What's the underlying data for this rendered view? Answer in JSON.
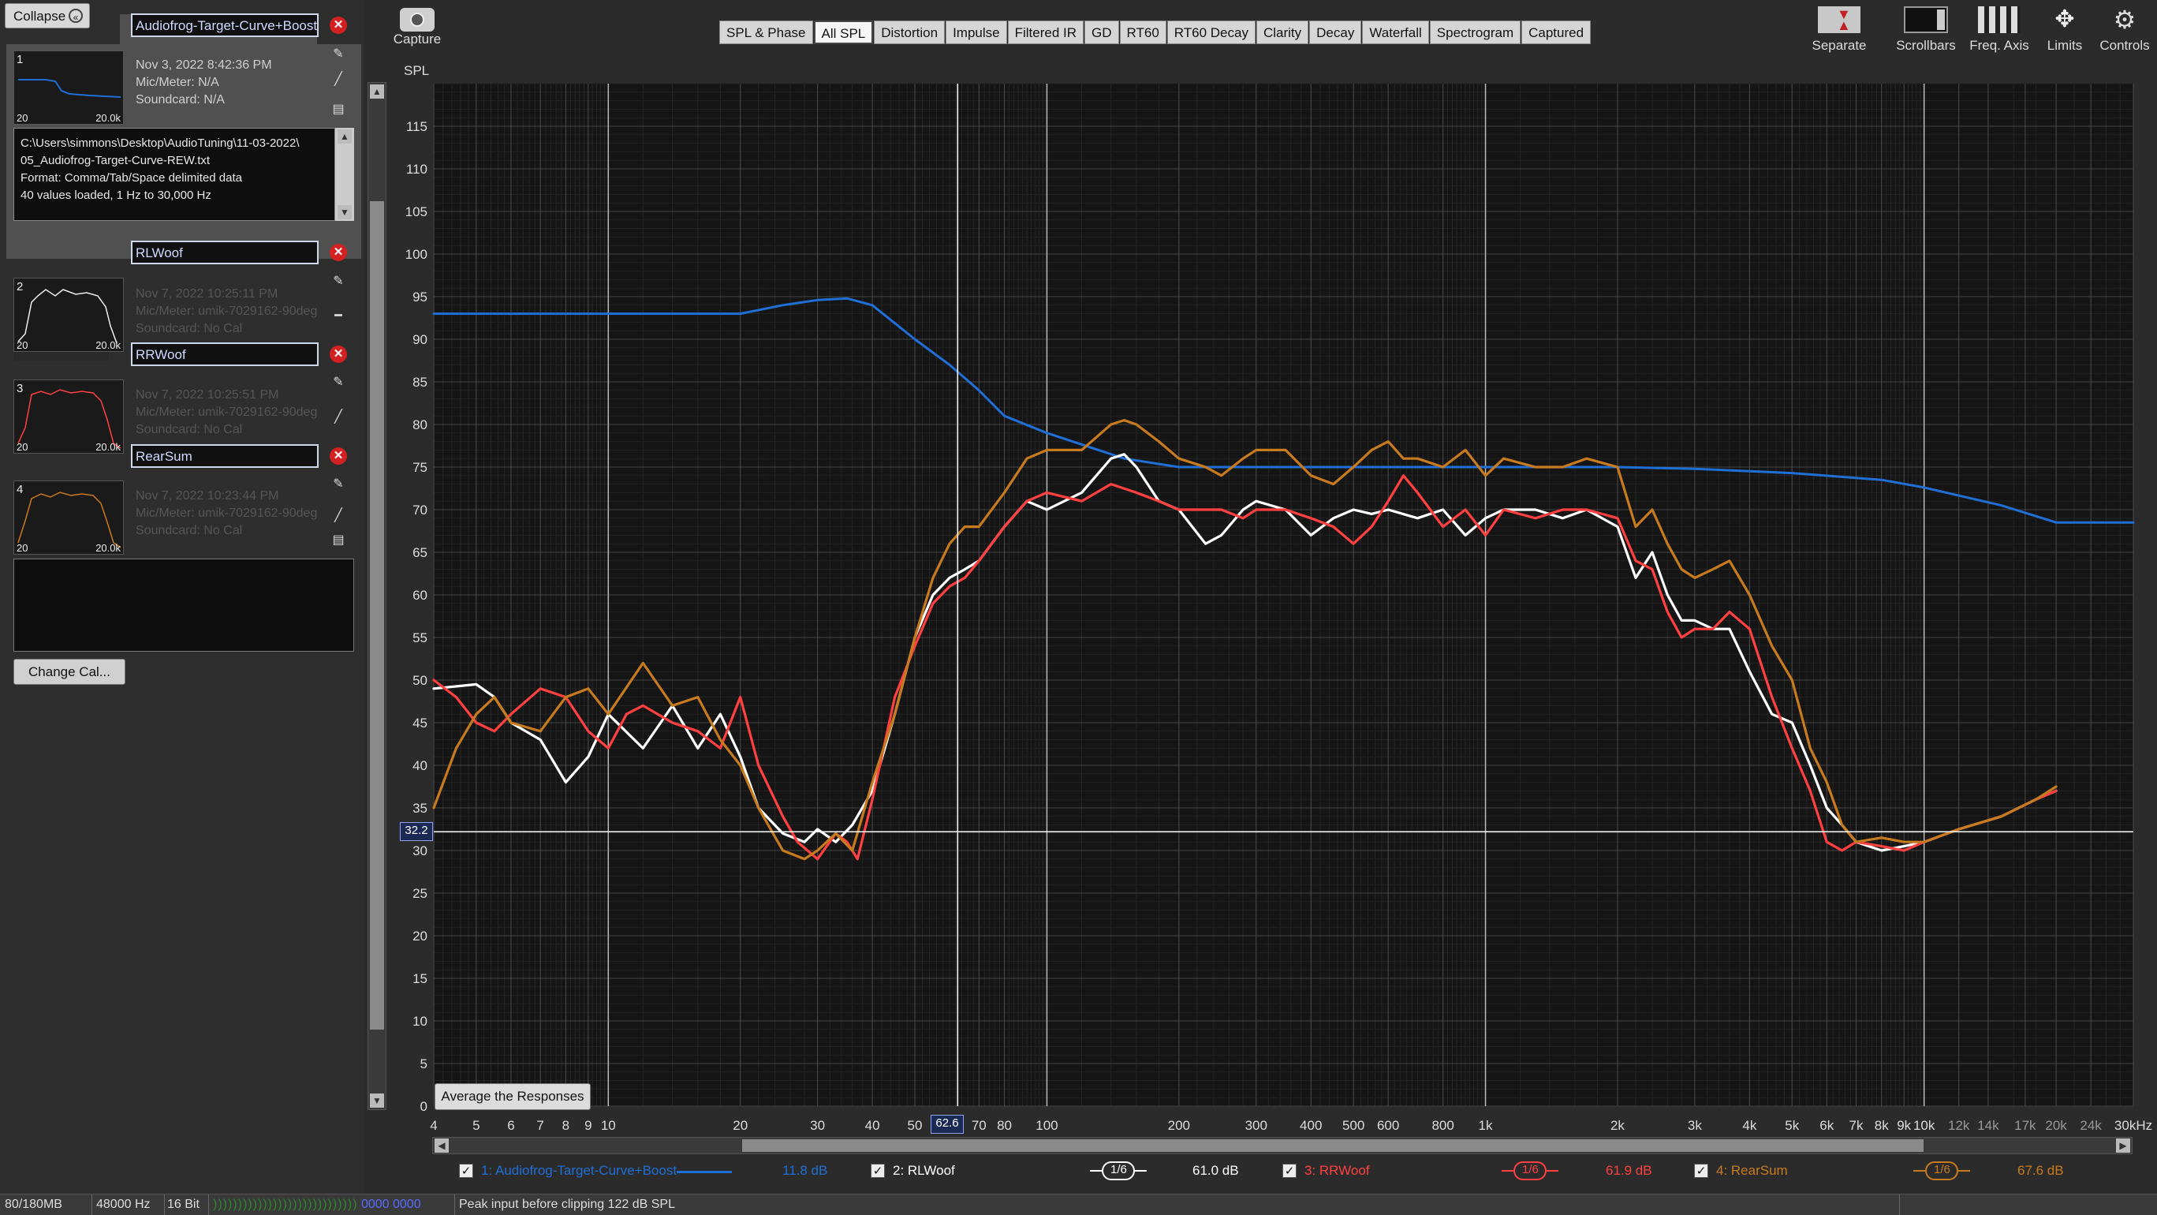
{
  "left_panel": {
    "collapse_label": "Collapse",
    "measurements": [
      {
        "index": "1",
        "name": "Audiofrog-Target-Curve+Boost",
        "date": "Nov 3, 2022 8:42:36 PM",
        "mic": "Mic/Meter: N/A",
        "soundcard": "Soundcard: N/A",
        "thumb_start": "20",
        "thumb_end": "20.0k",
        "color": "#1f6fd6"
      },
      {
        "index": "2",
        "name": "RLWoof",
        "date": "Nov 7, 2022 10:25:11 PM",
        "mic": "Mic/Meter: umik-7029162-90deg",
        "soundcard": "Soundcard: No Cal",
        "thumb_start": "20",
        "thumb_end": "20.0k",
        "color": "#ffffff"
      },
      {
        "index": "3",
        "name": "RRWoof",
        "date": "Nov 7, 2022 10:25:51 PM",
        "mic": "Mic/Meter: umik-7029162-90deg",
        "soundcard": "Soundcard: No Cal",
        "thumb_start": "20",
        "thumb_end": "20.0k",
        "color": "#ff4040"
      },
      {
        "index": "4",
        "name": "RearSum",
        "date": "Nov 7, 2022 10:23:44 PM",
        "mic": "Mic/Meter: umik-7029162-90deg",
        "soundcard": "Soundcard: No Cal",
        "thumb_start": "20",
        "thumb_end": "20.0k",
        "color": "#c87a1e"
      }
    ],
    "notes": "C:\\Users\\simmons\\Desktop\\AudioTuning\\11-03-2022\\\n05_Audiofrog-Target-Curve-REW.txt\nFormat: Comma/Tab/Space delimited data\n40 values loaded, 1 Hz to 30,000 Hz",
    "change_cal_label": "Change Cal..."
  },
  "toolbar": {
    "capture_label": "Capture",
    "tabs": [
      "SPL & Phase",
      "All SPL",
      "Distortion",
      "Impulse",
      "Filtered IR",
      "GD",
      "RT60",
      "RT60 Decay",
      "Clarity",
      "Decay",
      "Waterfall",
      "Spectrogram",
      "Captured"
    ],
    "active_tab": "All SPL",
    "right_buttons": [
      "Separate",
      "Scrollbars",
      "Freq. Axis",
      "Limits",
      "Controls"
    ]
  },
  "chart": {
    "y_axis_title": "SPL",
    "average_button": "Average the Responses",
    "cursor_y_readout": "32.2",
    "cursor_x_readout": "62.6"
  },
  "chart_data": {
    "type": "line",
    "xscale": "log",
    "xlim": [
      4,
      30000
    ],
    "ylim": [
      0,
      120
    ],
    "grid": true,
    "ylabel": "SPL",
    "y_ticks": [
      "0",
      "5",
      "10",
      "15",
      "20",
      "25",
      "30",
      "35",
      "40",
      "45",
      "50",
      "55",
      "60",
      "65",
      "70",
      "75",
      "80",
      "85",
      "90",
      "95",
      "100",
      "105",
      "110",
      "115"
    ],
    "x_ticks": [
      {
        "v": 4,
        "label": "4"
      },
      {
        "v": 5,
        "label": "5"
      },
      {
        "v": 6,
        "label": "6"
      },
      {
        "v": 7,
        "label": "7"
      },
      {
        "v": 8,
        "label": "8"
      },
      {
        "v": 9,
        "label": "9"
      },
      {
        "v": 10,
        "label": "10"
      },
      {
        "v": 20,
        "label": "20"
      },
      {
        "v": 30,
        "label": "30"
      },
      {
        "v": 40,
        "label": "40"
      },
      {
        "v": 50,
        "label": "50"
      },
      {
        "v": 70,
        "label": "70"
      },
      {
        "v": 80,
        "label": "80"
      },
      {
        "v": 100,
        "label": "100"
      },
      {
        "v": 200,
        "label": "200"
      },
      {
        "v": 300,
        "label": "300"
      },
      {
        "v": 400,
        "label": "400"
      },
      {
        "v": 500,
        "label": "500"
      },
      {
        "v": 600,
        "label": "600"
      },
      {
        "v": 800,
        "label": "800"
      },
      {
        "v": 1000,
        "label": "1k"
      },
      {
        "v": 2000,
        "label": "2k"
      },
      {
        "v": 3000,
        "label": "3k"
      },
      {
        "v": 4000,
        "label": "4k"
      },
      {
        "v": 5000,
        "label": "5k"
      },
      {
        "v": 6000,
        "label": "6k"
      },
      {
        "v": 7000,
        "label": "7k"
      },
      {
        "v": 8000,
        "label": "8k"
      },
      {
        "v": 9000,
        "label": "9k"
      },
      {
        "v": 10000,
        "label": "10k"
      },
      {
        "v": 12000,
        "label": "12k"
      },
      {
        "v": 14000,
        "label": "14k"
      },
      {
        "v": 17000,
        "label": "17k"
      },
      {
        "v": 20000,
        "label": "20k"
      },
      {
        "v": 24000,
        "label": "24k"
      },
      {
        "v": 30000,
        "label": "30kHz"
      }
    ],
    "cursor": {
      "x": 62.6,
      "y": 32.2
    },
    "series": [
      {
        "name": "Audiofrog-Target-Curve+Boost",
        "color": "#1f6fd6",
        "x": [
          4,
          10,
          20,
          25,
          30,
          35,
          40,
          50,
          60,
          70,
          80,
          100,
          150,
          200,
          300,
          500,
          1000,
          2000,
          3000,
          5000,
          8000,
          10000,
          15000,
          20000,
          30000
        ],
        "y": [
          93,
          93,
          93,
          94,
          94.6,
          94.8,
          94,
          90,
          87,
          84,
          81,
          79,
          76,
          75,
          75,
          75,
          75,
          75,
          74.8,
          74.3,
          73.5,
          72.6,
          70.5,
          68.5,
          68.5
        ]
      },
      {
        "name": "RLWoof",
        "color": "#ffffff",
        "x": [
          4,
          5,
          5.5,
          6,
          7,
          8,
          9,
          10,
          12,
          14,
          16,
          18,
          20,
          22,
          25,
          28,
          30,
          33,
          36,
          40,
          45,
          50,
          55,
          60,
          65,
          70,
          80,
          90,
          100,
          120,
          140,
          150,
          160,
          180,
          200,
          230,
          250,
          280,
          300,
          350,
          400,
          450,
          500,
          550,
          600,
          700,
          800,
          900,
          1000,
          1100,
          1300,
          1500,
          1700,
          2000,
          2200,
          2400,
          2600,
          2800,
          3000,
          3300,
          3600,
          4000,
          4500,
          5000,
          5500,
          6000,
          6500,
          7000,
          8000,
          9000,
          10000,
          12000,
          15000,
          18000,
          20000
        ],
        "y": [
          49,
          49.5,
          48,
          45,
          43,
          38,
          41,
          46,
          42,
          47,
          42,
          46,
          41,
          35,
          32,
          31,
          32.5,
          31,
          33,
          37,
          46,
          55,
          60,
          62,
          63,
          64,
          68,
          71,
          70,
          72,
          76,
          76.5,
          75,
          71,
          70,
          66,
          67,
          70,
          71,
          70,
          67,
          69,
          70,
          69.5,
          70,
          69,
          70,
          67,
          69,
          70,
          70,
          69,
          70,
          68,
          62,
          65,
          60,
          57,
          57,
          56,
          56,
          51,
          46,
          45,
          40,
          35,
          33,
          31,
          30,
          30.5,
          31,
          32.5,
          34,
          36,
          37
        ]
      },
      {
        "name": "RRWoof",
        "color": "#ff4040",
        "x": [
          4,
          4.5,
          5,
          5.5,
          6,
          7,
          8,
          9,
          10,
          11,
          12,
          14,
          16,
          18,
          20,
          22,
          25,
          27,
          30,
          33,
          35,
          37,
          40,
          45,
          50,
          55,
          60,
          65,
          70,
          80,
          90,
          100,
          120,
          140,
          160,
          180,
          200,
          230,
          250,
          280,
          300,
          350,
          400,
          450,
          500,
          550,
          600,
          650,
          700,
          800,
          900,
          1000,
          1100,
          1300,
          1500,
          1700,
          2000,
          2200,
          2400,
          2600,
          2800,
          3000,
          3300,
          3600,
          4000,
          4500,
          5000,
          5500,
          6000,
          6500,
          7000,
          8000,
          9000,
          10000,
          12000,
          15000,
          18000,
          20000
        ],
        "y": [
          50,
          48,
          45,
          44,
          46,
          49,
          48,
          44,
          42,
          46,
          47,
          45,
          44,
          42,
          48,
          40,
          34,
          31,
          29,
          32,
          31,
          29,
          36,
          48,
          54,
          59,
          61,
          62,
          64,
          68,
          71,
          72,
          71,
          73,
          72,
          71,
          70,
          70,
          70,
          69,
          70,
          70,
          69,
          68,
          66,
          68,
          71,
          74,
          72,
          68,
          70,
          67,
          70,
          69,
          70,
          70,
          69,
          64,
          63,
          58,
          55,
          56,
          56,
          58,
          56,
          48,
          42,
          37,
          31,
          30,
          31,
          30.5,
          30,
          31,
          32.5,
          34,
          36,
          37
        ]
      },
      {
        "name": "RearSum",
        "color": "#c87a1e",
        "x": [
          4,
          4.5,
          5,
          5.5,
          6,
          7,
          8,
          9,
          10,
          12,
          14,
          16,
          18,
          20,
          22,
          25,
          28,
          30,
          33,
          36,
          40,
          45,
          50,
          55,
          60,
          65,
          70,
          80,
          90,
          100,
          120,
          140,
          150,
          160,
          180,
          200,
          230,
          250,
          280,
          300,
          350,
          400,
          450,
          500,
          550,
          600,
          650,
          700,
          800,
          900,
          1000,
          1100,
          1300,
          1500,
          1700,
          2000,
          2200,
          2400,
          2600,
          2800,
          3000,
          3300,
          3600,
          4000,
          4500,
          5000,
          5500,
          6000,
          6500,
          7000,
          8000,
          9000,
          10000,
          12000,
          15000,
          18000,
          20000
        ],
        "y": [
          35,
          42,
          46,
          48,
          45,
          44,
          48,
          49,
          46,
          52,
          47,
          48,
          43,
          40,
          35,
          30,
          29,
          30,
          32,
          30,
          38,
          46,
          55,
          62,
          66,
          68,
          68,
          72,
          76,
          77,
          77,
          80,
          80.5,
          80,
          78,
          76,
          75,
          74,
          76,
          77,
          77,
          74,
          73,
          75,
          77,
          78,
          76,
          76,
          75,
          77,
          74,
          76,
          75,
          75,
          76,
          75,
          68,
          70,
          66,
          63,
          62,
          63,
          64,
          60,
          54,
          50,
          42,
          38,
          33,
          31,
          31.5,
          31,
          31,
          32.5,
          34,
          36,
          37.5
        ]
      }
    ]
  },
  "legend": {
    "items": [
      {
        "label": "1: Audiofrog-Target-Curve+Boost",
        "value": "11.8 dB",
        "color": "#1f6fd6",
        "smoothing": "",
        "checked": "✓"
      },
      {
        "label": "2: RLWoof",
        "value": "61.0 dB",
        "color": "#ffffff",
        "smoothing": "1/6",
        "checked": "✓"
      },
      {
        "label": "3: RRWoof",
        "value": "61.9 dB",
        "color": "#ff4040",
        "smoothing": "1/6",
        "checked": "✓"
      },
      {
        "label": "4: RearSum",
        "value": "67.6 dB",
        "color": "#c87a1e",
        "smoothing": "1/6",
        "checked": "✓"
      }
    ]
  },
  "status_bar": {
    "memory": "80/180MB",
    "sample_rate": "48000 Hz",
    "bit_depth": "16 Bit",
    "meter": "0000 0000",
    "peak_text": "Peak input before clipping 122 dB SPL"
  }
}
